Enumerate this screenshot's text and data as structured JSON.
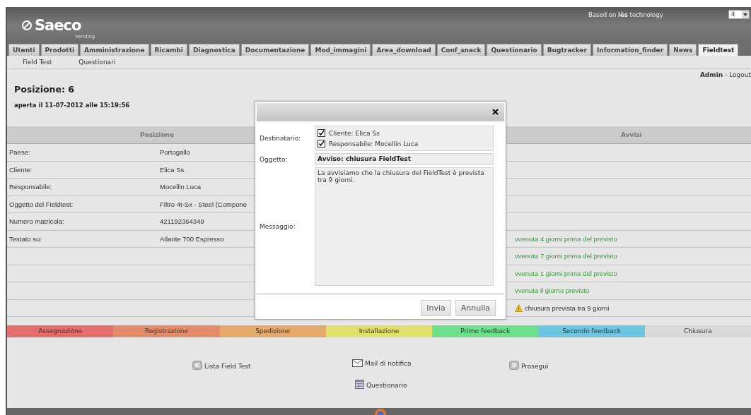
{
  "header": {
    "logo": "Saeco",
    "logo_sub": "Vending",
    "tagline": "Based on **iès** technology",
    "language": "it"
  },
  "tabs": [
    {
      "label": "Utenti",
      "selected": false
    },
    {
      "label": "Prodotti",
      "selected": false
    },
    {
      "label": "Amministrazione",
      "selected": false
    },
    {
      "label": "Ricambi",
      "selected": false
    },
    {
      "label": "Diagnostica",
      "selected": false
    },
    {
      "label": "Documentazione",
      "selected": false
    },
    {
      "label": "Mod_immagini",
      "selected": false
    },
    {
      "label": "Area_download",
      "selected": false
    },
    {
      "label": "Conf_snack",
      "selected": false
    },
    {
      "label": "Questionario",
      "selected": false
    },
    {
      "label": "Bugtracker",
      "selected": false
    },
    {
      "label": "Information_finder",
      "selected": false
    },
    {
      "label": "News",
      "selected": false
    },
    {
      "label": "Fieldtest",
      "selected": true
    }
  ],
  "subnav": [
    "Field Test",
    "Questionari"
  ],
  "user": {
    "name": "Admin",
    "separator": "-",
    "logout": "Logout"
  },
  "title": "Posizione: 6",
  "opened": "aperta il 11-07-2012 alle 15:19:56",
  "table": {
    "columns": [
      "Posizione",
      "Avvisi"
    ],
    "rows": [
      {
        "label": "Paese:",
        "value": "Portogallo"
      },
      {
        "label": "Cliente:",
        "value": "Elica Ss"
      },
      {
        "label": "Responsabile:",
        "value": "Mocellin Luca"
      },
      {
        "label": "Oggetto del Fieldtest:",
        "value": "Filtro 4t-Sx - Steel (Compone"
      },
      {
        "label": "Numero matricola:",
        "value": "421192364349"
      },
      {
        "label": "Testato su:",
        "value": "Atlante 700 Espresso",
        "alert": {
          "kind": "success",
          "text": "vvenuta 4 giorni prima del previsto"
        }
      },
      {
        "alert": {
          "kind": "success",
          "text": "vvenuta 7 giorni prima del previsto"
        }
      },
      {
        "alert": {
          "kind": "success",
          "text": "vvenuta 1 giorni prima del previsto"
        }
      },
      {
        "alert": {
          "kind": "success",
          "text": "vvenuta il giorno previsto"
        }
      },
      {
        "alert": {
          "kind": "warning",
          "text": "chiusura prevista tra 9 giorni"
        }
      }
    ]
  },
  "stages": [
    {
      "label": "Assegnazione",
      "color": "#e46e6e"
    },
    {
      "label": "Registrazione",
      "color": "#e38c6c"
    },
    {
      "label": "Spedizione",
      "color": "#e4aa6c"
    },
    {
      "label": "Installazione",
      "color": "#e0e06c"
    },
    {
      "label": "Primo feedback",
      "color": "#6ee08c"
    },
    {
      "label": "Secondo feedback",
      "color": "#6ec5e0"
    },
    {
      "label": "Chiusura",
      "color": "#d9d9d9"
    }
  ],
  "links": [
    {
      "kind": "back",
      "label": "Lista Field Test"
    },
    {
      "kind": "mail",
      "label": "Mail di notifica"
    },
    {
      "kind": "forward",
      "label": "Prosegui"
    },
    {
      "kind": "form",
      "label": "Questionario"
    }
  ],
  "dialog": {
    "recipients_label": "Destinatario:",
    "recipients": [
      {
        "label": "Cliente: Elica Ss",
        "checked": true
      },
      {
        "label": "Responsabile: Mocellin Luca",
        "checked": true
      }
    ],
    "subject_label": "Oggetto:",
    "subject": "Avviso: chiusura FieldTest",
    "message_label": "Messaggio:",
    "message": "La avvisiamo che la chiusura del FieldTest è prevista tra 9 giorni.",
    "buttons": [
      "Invia",
      "Annulla"
    ]
  }
}
